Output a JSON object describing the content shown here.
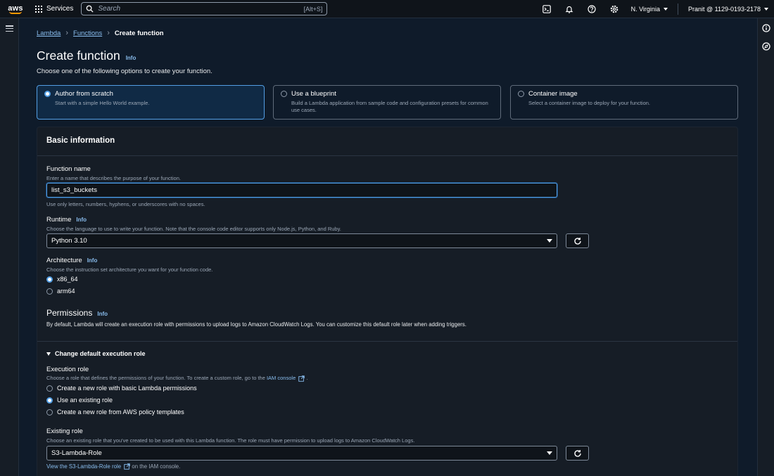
{
  "topnav": {
    "logo": "aws",
    "services_label": "Services",
    "search_placeholder": "Search",
    "search_shortcut": "[Alt+S]",
    "region": "N. Virginia",
    "account": "Pranit @ 1129-0193-2178"
  },
  "breadcrumb": {
    "items": [
      "Lambda",
      "Functions"
    ],
    "current": "Create function"
  },
  "page": {
    "title": "Create function",
    "info_label": "Info",
    "description": "Choose one of the following options to create your function."
  },
  "options": [
    {
      "label": "Author from scratch",
      "description": "Start with a simple Hello World example.",
      "selected": true
    },
    {
      "label": "Use a blueprint",
      "description": "Build a Lambda application from sample code and configuration presets for common use cases.",
      "selected": false
    },
    {
      "label": "Container image",
      "description": "Select a container image to deploy for your function.",
      "selected": false
    }
  ],
  "basic_info": {
    "heading": "Basic information",
    "function_name": {
      "label": "Function name",
      "description": "Enter a name that describes the purpose of your function.",
      "value": "list_s3_buckets",
      "hint": "Use only letters, numbers, hyphens, or underscores with no spaces."
    },
    "runtime": {
      "label": "Runtime",
      "info": "Info",
      "description": "Choose the language to use to write your function. Note that the console code editor supports only Node.js, Python, and Ruby.",
      "value": "Python 3.10"
    },
    "architecture": {
      "label": "Architecture",
      "info": "Info",
      "description": "Choose the instruction set architecture you want for your function code.",
      "options": [
        "x86_64",
        "arm64"
      ],
      "selected": "x86_64"
    },
    "permissions": {
      "title": "Permissions",
      "info": "Info",
      "text": "By default, Lambda will create an execution role with permissions to upload logs to Amazon CloudWatch Logs. You can customize this default role later when adding triggers."
    }
  },
  "execution_role": {
    "expander": "Change default execution role",
    "label": "Execution role",
    "description": "Choose a role that defines the permissions of your function. To create a custom role, go to the",
    "iam_link": "IAM console",
    "description_end": ".",
    "options": [
      "Create a new role with basic Lambda permissions",
      "Use an existing role",
      "Create a new role from AWS policy templates"
    ],
    "selected": "Use an existing role"
  },
  "existing_role": {
    "label": "Existing role",
    "description": "Choose an existing role that you've created to be used with this Lambda function. The role must have permission to upload logs to Amazon CloudWatch Logs.",
    "value": "S3-Lambda-Role",
    "view_link": "View the S3-Lambda-Role role",
    "view_suffix": "on the IAM console."
  },
  "colors": {
    "accent": "#539fe5",
    "link": "#89bdee",
    "background": "#0f1b2a",
    "card": "#161d26"
  }
}
